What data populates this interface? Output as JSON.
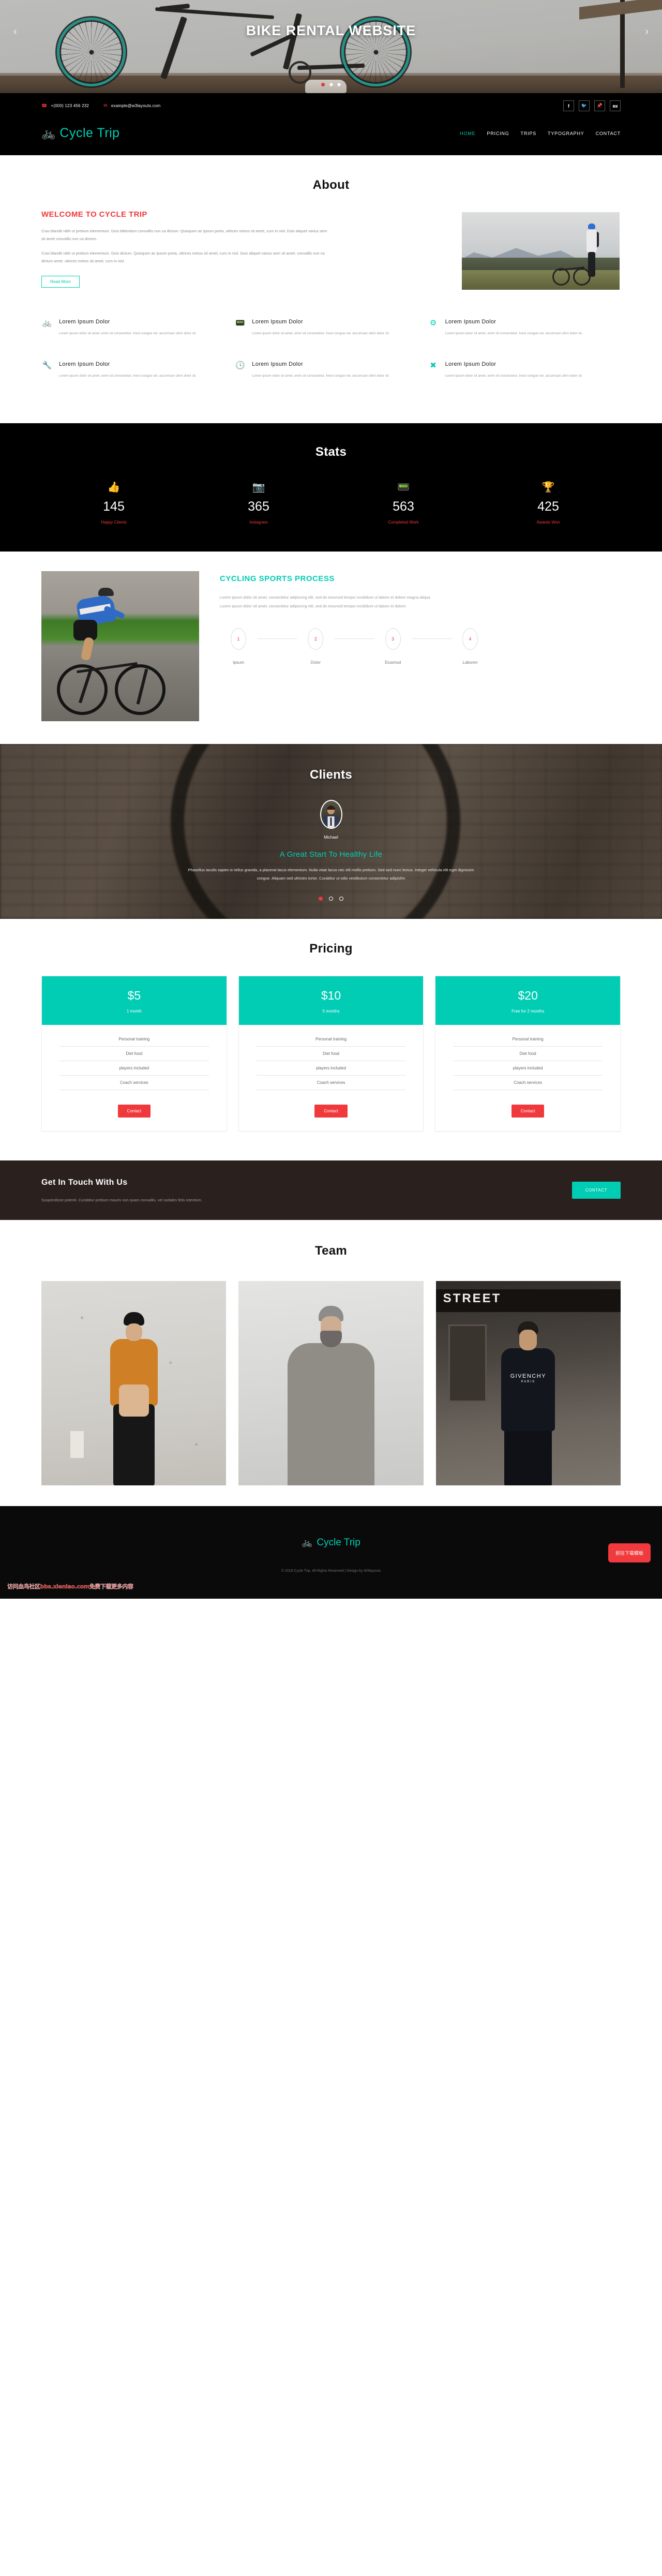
{
  "hero": {
    "title": "BIKE RENTAL WEBSITE",
    "prev_icon": "‹",
    "next_icon": "›",
    "dots": [
      "active",
      "",
      ""
    ]
  },
  "topbar": {
    "phone": "+(000) 123 456 232",
    "email": "example@w3layouts.com",
    "phone_icon": "☎",
    "mail_icon": "✉",
    "socials": [
      {
        "name": "facebook",
        "glyph": "f"
      },
      {
        "name": "twitter",
        "glyph": "🐦"
      },
      {
        "name": "pinterest",
        "glyph": "📌"
      },
      {
        "name": "vk",
        "glyph": "вк"
      }
    ]
  },
  "brand": {
    "icon": "🚲",
    "name": "Cycle Trip"
  },
  "nav": [
    {
      "label": "HOME",
      "active": true
    },
    {
      "label": "PRICING",
      "active": false
    },
    {
      "label": "TRIPS",
      "active": false
    },
    {
      "label": "TYPOGRAPHY",
      "active": false
    },
    {
      "label": "CONTACT",
      "active": false
    }
  ],
  "about": {
    "section_title": "About",
    "heading": "WELCOME TO CYCLE TRIP",
    "p1": "Cras blandit nibh ut pretium elementum. Duis bibendum convallis nun ca dictum. Quisquen ac ipsum porta, ultrices metus sit amet, curs in nisl. Duis aliquet varius sem sit amet convallis nun ca dictum.",
    "p2": "Cras blandit nibh ut pretium elementum. Duis dictum. Quisquen ac ipsum porta, ultrices metus sit amet, curs in nisl. Duis aliquet varius sem sit amet. convallis nun ca dictum amet. ultrices metus sit amet, curs in nisl.",
    "read_more": "Read More"
  },
  "features": [
    {
      "icon": "🚲",
      "icon_name": "bicycle-icon",
      "title": "Lorem Ipsum Dolor",
      "text": "Lorem ipsum dolor sit amet, enim sit consectetur. Inest congue vel. accumsan ultrin dolor sit."
    },
    {
      "icon": "📟",
      "icon_name": "radio-icon",
      "title": "Lorem Ipsum Dolor",
      "text": "Lorem ipsum dolor sit amet, enim sit consectetur. Inest congue vel. accumsan ultrin dolor sit."
    },
    {
      "icon": "⚙",
      "icon_name": "gears-icon",
      "title": "Lorem Ipsum Dolor",
      "text": "Lorem ipsum dolor sit amet, enim sit consectetur. Inest congue vel. accumsan ultrin dolor sit."
    },
    {
      "icon": "🔧",
      "icon_name": "wrench-icon",
      "title": "Lorem Ipsum Dolor",
      "text": "Lorem ipsum dolor sit amet, enim sit consectetur. Inest congue vel. accumsan ultrin dolor sit."
    },
    {
      "icon": "🕓",
      "icon_name": "clock-icon",
      "title": "Lorem Ipsum Dolor",
      "text": "Lorem ipsum dolor sit amet, enim sit consectetur. Inest congue vel. accumsan ultrin dolor sit."
    },
    {
      "icon": "✖",
      "icon_name": "close-circle-icon",
      "title": "Lorem Ipsum Dolor",
      "text": "Lorem ipsum dolor sit amet, enim sit consectetur. Inest congue vel. accumsan ultrin dolor sit."
    }
  ],
  "stats": {
    "section_title": "Stats",
    "items": [
      {
        "icon": "👍",
        "icon_name": "thumbs-up-icon",
        "value": "145",
        "label": "Happy Clients"
      },
      {
        "icon": "📷",
        "icon_name": "instagram-icon",
        "value": "365",
        "label": "Instagram"
      },
      {
        "icon": "📟",
        "icon_name": "radio-icon",
        "value": "563",
        "label": "Completed Work"
      },
      {
        "icon": "🏆",
        "icon_name": "trophy-icon",
        "value": "425",
        "label": "Awards Won"
      }
    ]
  },
  "process": {
    "heading": "CYCLING SPORTS PROCESS",
    "p1": "Lorem ipsum dolor sit amet, consectetur adipiscing elit, sed do eiusmod tempor incididunt ut labore et dolore magna aliqua.",
    "p2": "Lorem ipsum dolor sit amet, consectetur adipiscing elit, sed do eiusmod tempor incididunt ut labore et dolore.",
    "steps": [
      {
        "num": "1",
        "label": "Ipsum"
      },
      {
        "num": "2",
        "label": "Dolor"
      },
      {
        "num": "3",
        "label": "Eiusmod"
      },
      {
        "num": "4",
        "label": "Laboren"
      }
    ]
  },
  "clients": {
    "section_title": "Clients",
    "name": "Michael",
    "heading": "A Great Start To Healthy Life",
    "quote": "Phasellus iaculis sapien in tellus gravida, a placerat lacus elementum. Nulla vitae lacus nec elit mollis pretium. Sed sed nunc lectus. Integer vehicula elit eget dignissim congue. Aliquam sed ultricies tortor. Curabitur ut odio vestibulum consectetur adipisthn",
    "dots": [
      "active",
      "",
      ""
    ]
  },
  "pricing": {
    "section_title": "Pricing",
    "plans": [
      {
        "amount": "$5",
        "period": "1 month",
        "features": [
          "Personal training",
          "Diet food",
          "players included",
          "Coach services"
        ],
        "button": "Contact"
      },
      {
        "amount": "$10",
        "period": "5 months",
        "features": [
          "Personal training",
          "Diet food",
          "players included",
          "Coach services"
        ],
        "button": "Contact"
      },
      {
        "amount": "$20",
        "period": "Free for 2 months",
        "features": [
          "Personal training",
          "Diet food",
          "players included",
          "Coach services"
        ],
        "button": "Contact"
      }
    ]
  },
  "touch": {
    "heading": "Get In Touch With Us",
    "text": "Suspendisse potenti. Curabitur pretium mauris non quam convallis, vel sodales felis interdum.",
    "button": "CONTACT"
  },
  "team": {
    "section_title": "Team",
    "members": [
      {
        "alt": "team-member-1"
      },
      {
        "alt": "team-member-2"
      },
      {
        "alt": "team-member-3",
        "shirt_brand": "GIVENCHY",
        "shirt_sub": "PARIS",
        "sign": "STREET"
      }
    ]
  },
  "footer": {
    "copyright": "© 2018 Cycle Trip. All Rights Reserved | Design by W3layouts",
    "download_button": "前往下载模板",
    "watermark": "访问血鸟社区bbs.xieniao.com免费下载更多内容"
  },
  "colors": {
    "accent_teal": "#00cdb4",
    "accent_red": "#f0393c",
    "dark": "#000000",
    "touch_bg": "#2a211e"
  }
}
